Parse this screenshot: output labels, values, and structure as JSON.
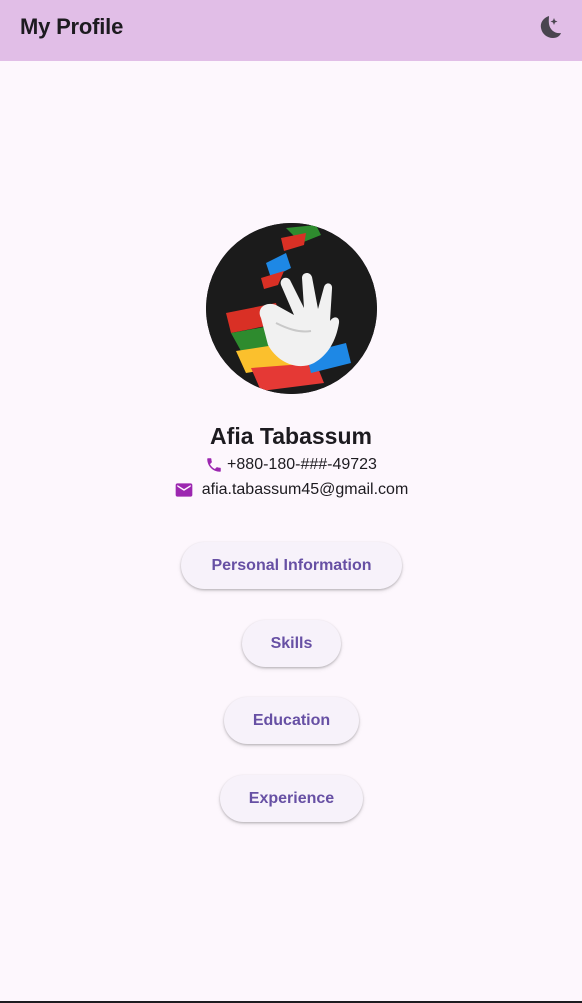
{
  "appbar": {
    "title": "My Profile",
    "theme_icon": "moon-icon"
  },
  "profile": {
    "name": "Afia Tabassum",
    "phone": "+880-180-###-49723",
    "email": "afia.tabassum45@gmail.com",
    "phone_icon": "phone-icon",
    "email_icon": "email-icon"
  },
  "menu": {
    "personal_information": "Personal Information",
    "skills": "Skills",
    "education": "Education",
    "experience": "Experience"
  },
  "colors": {
    "appbar": "#e1bee7",
    "background": "#fdf7fd",
    "accent": "#6750a4",
    "icon": "#9c27b0"
  }
}
